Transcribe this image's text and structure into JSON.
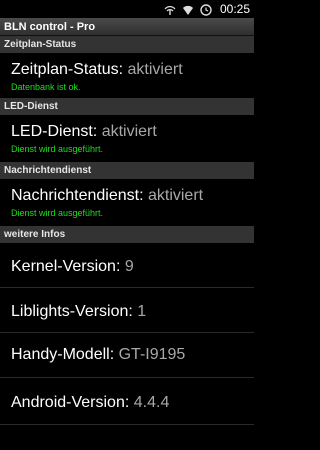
{
  "status_bar": {
    "icons": [
      "signal-hotspot-icon",
      "wifi-icon",
      "alarm-icon"
    ],
    "time": "00:25"
  },
  "app": {
    "title": "BLN control - Pro"
  },
  "sections": {
    "zeitplan": {
      "header": "Zeitplan-Status",
      "label": "Zeitplan-Status:",
      "value": "aktiviert",
      "sub": "Datenbank ist ok."
    },
    "led": {
      "header": "LED-Dienst",
      "label": "LED-Dienst:",
      "value": "aktiviert",
      "sub": "Dienst wird ausgeführt."
    },
    "nachrichten": {
      "header": "Nachrichtendienst",
      "label": "Nachrichtendienst:",
      "value": "aktiviert",
      "sub": "Dienst wird ausgeführt."
    },
    "infos": {
      "header": "weitere Infos",
      "items": [
        {
          "label": "Kernel-Version:",
          "value": "9"
        },
        {
          "label": "Liblights-Version:",
          "value": "1"
        },
        {
          "label": "Handy-Modell:",
          "value": "GT-I9195"
        },
        {
          "label": "Android-Version:",
          "value": "4.4.4"
        }
      ]
    }
  },
  "colors": {
    "background": "#000000",
    "section_header": "#333333",
    "value_text": "#a8a8a8",
    "status_green": "#19e219"
  }
}
